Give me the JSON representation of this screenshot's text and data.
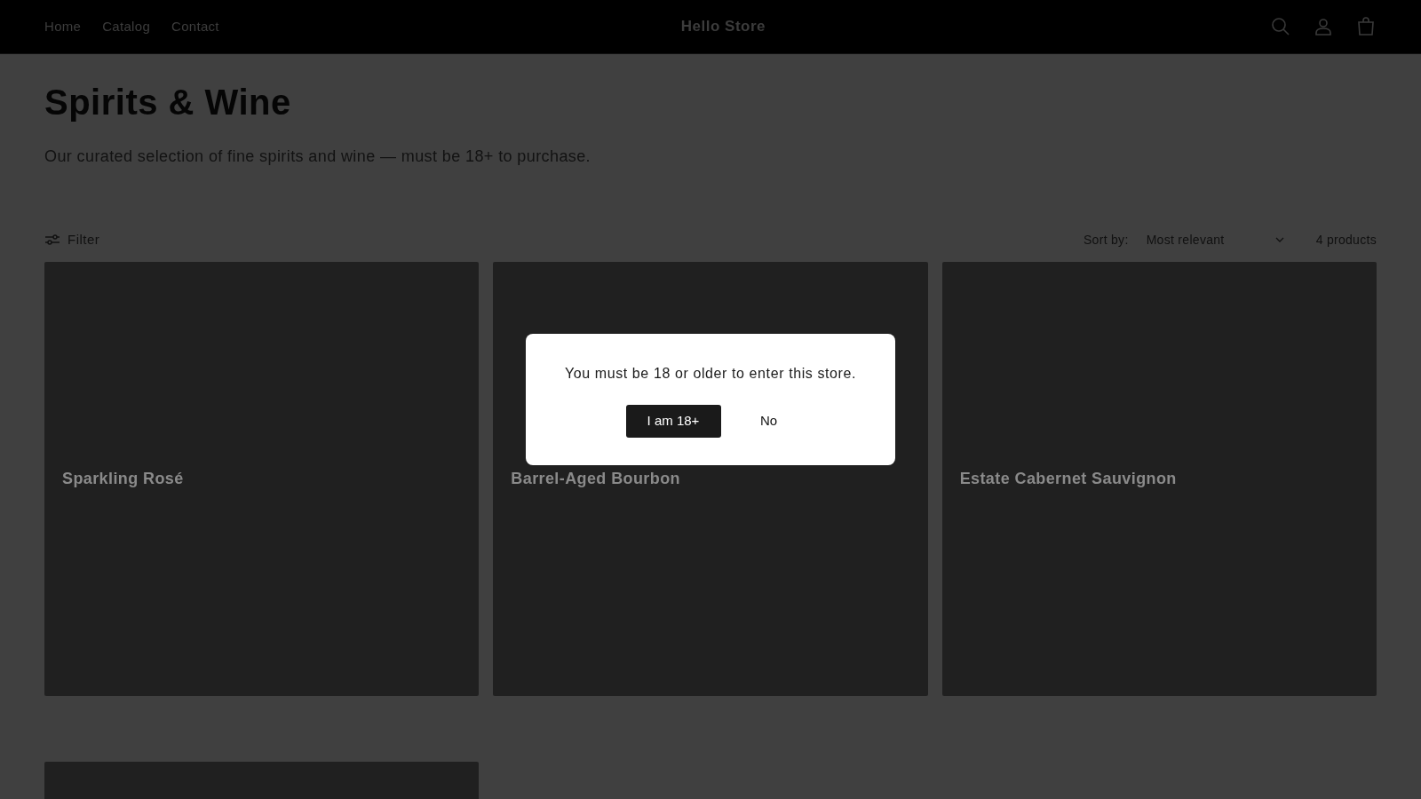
{
  "header": {
    "nav": [
      "Home",
      "Catalog",
      "Contact"
    ],
    "store_name": "Hello Store"
  },
  "collection": {
    "title": "Spirits & Wine",
    "description": "Our curated selection of fine spirits and wine — must be 18+ to purchase."
  },
  "toolbar": {
    "filter_label": "Filter",
    "sort_label": "Sort by:",
    "sort_value": "Most relevant",
    "product_count": "4 products"
  },
  "products": [
    {
      "kind": "titled",
      "title": "Sparkling Rosé"
    },
    {
      "kind": "titled",
      "title": "Barrel-Aged Bourbon"
    },
    {
      "kind": "titled",
      "title": "Estate Cabernet Sauvignon"
    },
    {
      "kind": "blank"
    }
  ],
  "age_gate": {
    "message": "You must be 18 or older to enter this store.",
    "buttons": [
      {
        "label": "I am 18+",
        "kind": "primary"
      },
      {
        "label": "No",
        "kind": "plain"
      }
    ]
  }
}
